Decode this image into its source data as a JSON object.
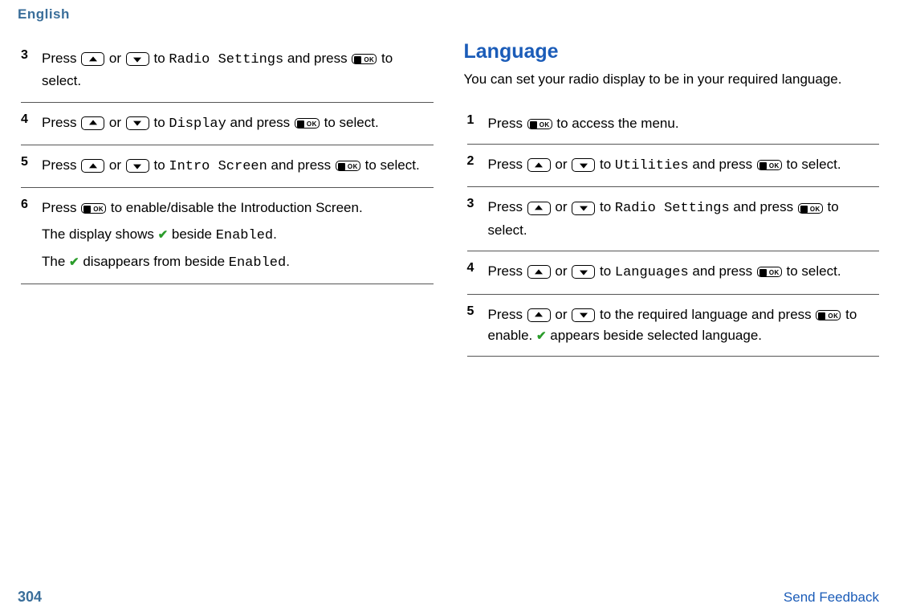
{
  "header": {
    "language": "English"
  },
  "left_steps": [
    {
      "num": "3",
      "parts": [
        {
          "t": "text",
          "v": "Press "
        },
        {
          "t": "up"
        },
        {
          "t": "text",
          "v": " or "
        },
        {
          "t": "down"
        },
        {
          "t": "text",
          "v": " to "
        },
        {
          "t": "mono",
          "v": "Radio Settings"
        },
        {
          "t": "text",
          "v": " and press "
        },
        {
          "t": "ok"
        },
        {
          "t": "text",
          "v": " to select."
        }
      ]
    },
    {
      "num": "4",
      "parts": [
        {
          "t": "text",
          "v": "Press "
        },
        {
          "t": "up"
        },
        {
          "t": "text",
          "v": " or "
        },
        {
          "t": "down"
        },
        {
          "t": "text",
          "v": " to "
        },
        {
          "t": "mono",
          "v": "Display"
        },
        {
          "t": "text",
          "v": " and press "
        },
        {
          "t": "ok"
        },
        {
          "t": "text",
          "v": " to select."
        }
      ]
    },
    {
      "num": "5",
      "parts": [
        {
          "t": "text",
          "v": "Press "
        },
        {
          "t": "up"
        },
        {
          "t": "text",
          "v": " or "
        },
        {
          "t": "down"
        },
        {
          "t": "text",
          "v": " to "
        },
        {
          "t": "mono",
          "v": "Intro Screen"
        },
        {
          "t": "text",
          "v": " and press "
        },
        {
          "t": "ok"
        },
        {
          "t": "text",
          "v": " to select."
        }
      ]
    },
    {
      "num": "6",
      "paragraphs": [
        [
          {
            "t": "text",
            "v": "Press "
          },
          {
            "t": "ok"
          },
          {
            "t": "text",
            "v": " to enable/disable the Introduction Screen."
          }
        ],
        [
          {
            "t": "text",
            "v": "The display shows "
          },
          {
            "t": "chk"
          },
          {
            "t": "text",
            "v": " beside "
          },
          {
            "t": "mono",
            "v": "Enabled"
          },
          {
            "t": "text",
            "v": "."
          }
        ],
        [
          {
            "t": "text",
            "v": "The "
          },
          {
            "t": "chk"
          },
          {
            "t": "text",
            "v": " disappears from beside "
          },
          {
            "t": "mono",
            "v": "Enabled"
          },
          {
            "t": "text",
            "v": "."
          }
        ]
      ]
    }
  ],
  "right": {
    "title": "Language",
    "intro": "You can set your radio display to be in your required language.",
    "steps": [
      {
        "num": "1",
        "parts": [
          {
            "t": "text",
            "v": "Press "
          },
          {
            "t": "ok"
          },
          {
            "t": "text",
            "v": " to access the menu."
          }
        ]
      },
      {
        "num": "2",
        "parts": [
          {
            "t": "text",
            "v": "Press "
          },
          {
            "t": "up"
          },
          {
            "t": "text",
            "v": " or "
          },
          {
            "t": "down"
          },
          {
            "t": "text",
            "v": " to "
          },
          {
            "t": "mono",
            "v": "Utilities"
          },
          {
            "t": "text",
            "v": " and press "
          },
          {
            "t": "ok"
          },
          {
            "t": "text",
            "v": " to select."
          }
        ]
      },
      {
        "num": "3",
        "parts": [
          {
            "t": "text",
            "v": "Press "
          },
          {
            "t": "up"
          },
          {
            "t": "text",
            "v": " or "
          },
          {
            "t": "down"
          },
          {
            "t": "text",
            "v": " to "
          },
          {
            "t": "mono",
            "v": "Radio Settings"
          },
          {
            "t": "text",
            "v": " and press "
          },
          {
            "t": "ok"
          },
          {
            "t": "text",
            "v": " to select."
          }
        ]
      },
      {
        "num": "4",
        "parts": [
          {
            "t": "text",
            "v": "Press "
          },
          {
            "t": "up"
          },
          {
            "t": "text",
            "v": " or "
          },
          {
            "t": "down"
          },
          {
            "t": "text",
            "v": " to "
          },
          {
            "t": "mono",
            "v": "Languages"
          },
          {
            "t": "text",
            "v": " and press "
          },
          {
            "t": "ok"
          },
          {
            "t": "text",
            "v": " to select."
          }
        ]
      },
      {
        "num": "5",
        "parts": [
          {
            "t": "text",
            "v": "Press "
          },
          {
            "t": "up"
          },
          {
            "t": "text",
            "v": " or "
          },
          {
            "t": "down"
          },
          {
            "t": "text",
            "v": " to the required language and press "
          },
          {
            "t": "ok"
          },
          {
            "t": "text",
            "v": " to enable. "
          },
          {
            "t": "chk"
          },
          {
            "t": "text",
            "v": " appears beside selected language."
          }
        ]
      }
    ]
  },
  "footer": {
    "page": "304",
    "feedback": "Send Feedback"
  }
}
